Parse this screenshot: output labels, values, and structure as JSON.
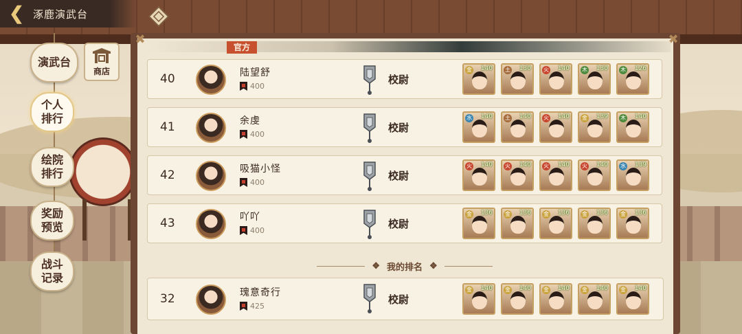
{
  "header": {
    "title": "涿鹿演武台",
    "back_icon": "back-arrow-icon",
    "extra_icon": "diamond-menu-icon"
  },
  "nav": {
    "items": [
      {
        "id": "arena",
        "label": "演武台",
        "active": false
      },
      {
        "id": "personal",
        "label": "个人排行",
        "active": true
      },
      {
        "id": "academy",
        "label": "绘院排行",
        "active": false
      },
      {
        "id": "reward",
        "label": "奖励预览",
        "active": false
      },
      {
        "id": "battle",
        "label": "战斗记录",
        "active": false
      }
    ],
    "shop_label": "商店",
    "shop_icon": "shop-gate-icon"
  },
  "tab": {
    "label": "官方"
  },
  "rows": [
    {
      "rank": "40",
      "name": "陆望舒",
      "score": "400",
      "title": "校尉",
      "team": [
        {
          "elem": "金",
          "elem_color": "#c9a23b",
          "level": "140"
        },
        {
          "elem": "土",
          "elem_color": "#a46a3a",
          "level": "130"
        },
        {
          "elem": "火",
          "elem_color": "#c8452e",
          "level": "140"
        },
        {
          "elem": "木",
          "elem_color": "#4c8a3b",
          "level": "130"
        },
        {
          "elem": "木",
          "elem_color": "#4c8a3b",
          "level": "126"
        }
      ]
    },
    {
      "rank": "41",
      "name": "余虔",
      "score": "400",
      "title": "校尉",
      "team": [
        {
          "elem": "水",
          "elem_color": "#3a86b0",
          "level": "140"
        },
        {
          "elem": "土",
          "elem_color": "#a46a3a",
          "level": "140"
        },
        {
          "elem": "火",
          "elem_color": "#c8452e",
          "level": "140"
        },
        {
          "elem": "金",
          "elem_color": "#c9a23b",
          "level": "139"
        },
        {
          "elem": "木",
          "elem_color": "#4c8a3b",
          "level": "140"
        }
      ]
    },
    {
      "rank": "42",
      "name": "吸猫小怪",
      "score": "400",
      "title": "校尉",
      "team": [
        {
          "elem": "火",
          "elem_color": "#c8452e",
          "level": "140"
        },
        {
          "elem": "火",
          "elem_color": "#c8452e",
          "level": "140"
        },
        {
          "elem": "火",
          "elem_color": "#c8452e",
          "level": "140"
        },
        {
          "elem": "火",
          "elem_color": "#c8452e",
          "level": "140"
        },
        {
          "elem": "水",
          "elem_color": "#3a86b0",
          "level": "139"
        }
      ]
    },
    {
      "rank": "43",
      "name": "吖吖",
      "score": "400",
      "title": "校尉",
      "team": [
        {
          "elem": "金",
          "elem_color": "#c9a23b",
          "level": "136"
        },
        {
          "elem": "金",
          "elem_color": "#c9a23b",
          "level": "136"
        },
        {
          "elem": "金",
          "elem_color": "#c9a23b",
          "level": "136"
        },
        {
          "elem": "金",
          "elem_color": "#c9a23b",
          "level": "136"
        },
        {
          "elem": "金",
          "elem_color": "#c9a23b",
          "level": "136"
        }
      ]
    }
  ],
  "my_rank": {
    "divider_label": "我的排名",
    "rank": "32",
    "name": "瑰意奇行",
    "score": "425",
    "title": "校尉",
    "team": [
      {
        "elem": "金",
        "elem_color": "#c9a23b",
        "level": "140"
      },
      {
        "elem": "金",
        "elem_color": "#c9a23b",
        "level": "140"
      },
      {
        "elem": "金",
        "elem_color": "#c9a23b",
        "level": "140"
      },
      {
        "elem": "金",
        "elem_color": "#c9a23b",
        "level": "140"
      },
      {
        "elem": "金",
        "elem_color": "#c9a23b",
        "level": "140"
      }
    ]
  },
  "colors": {
    "accent": "#c7512f",
    "panel": "#efe6d3",
    "frame": "#6c4632"
  }
}
